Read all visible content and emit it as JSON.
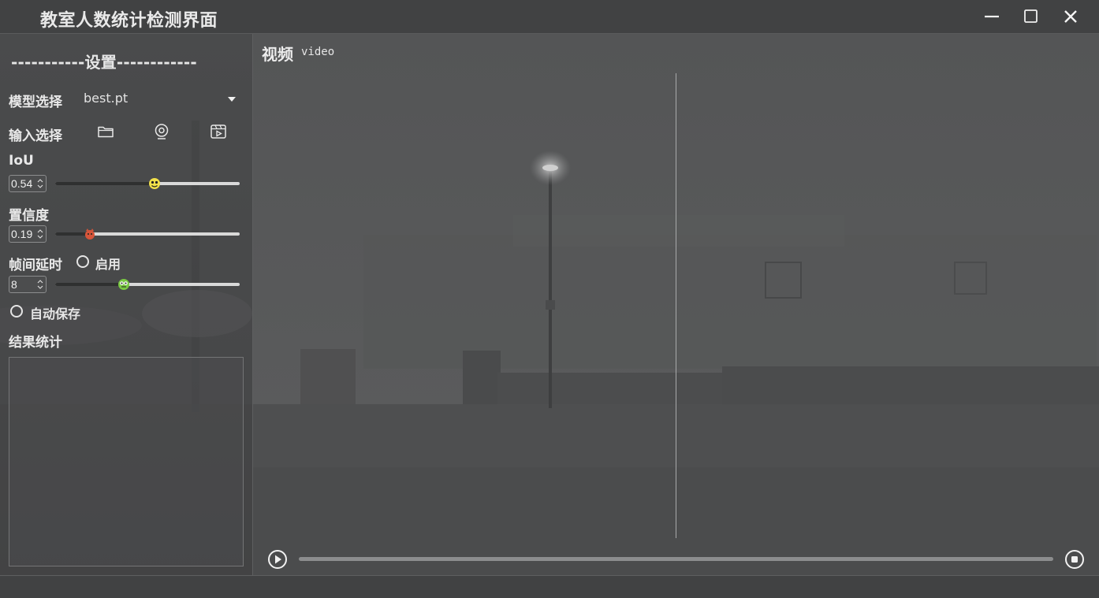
{
  "window": {
    "title": "教室人数统计检测界面",
    "controls": [
      "minimize-icon",
      "maximize-icon",
      "close-icon"
    ]
  },
  "sidebar": {
    "settings_title": "-----------设置------------",
    "model": {
      "label": "模型选择",
      "value": "best.pt"
    },
    "input": {
      "label": "输入选择",
      "icons": [
        "folder-icon",
        "webcam-icon",
        "video-file-icon"
      ]
    },
    "iou": {
      "label": "IoU",
      "value": "0.54",
      "level": 0.54
    },
    "confidence": {
      "label": "置信度",
      "value": "0.19",
      "level": 0.19
    },
    "frame_delay": {
      "label": "帧间延时",
      "enable_label": "启用",
      "value": "8",
      "level": 0.37
    },
    "auto_save": {
      "label": "自动保存"
    },
    "results": {
      "label": "结果统计"
    }
  },
  "main": {
    "video_label": "视频",
    "video_sublabel": "video",
    "controls": [
      "play-icon",
      "stop-icon"
    ]
  },
  "colors": {
    "background": "#404142",
    "panel": "#525354",
    "slider_track": "#d9d9d9",
    "text": "#e8e8e8"
  }
}
